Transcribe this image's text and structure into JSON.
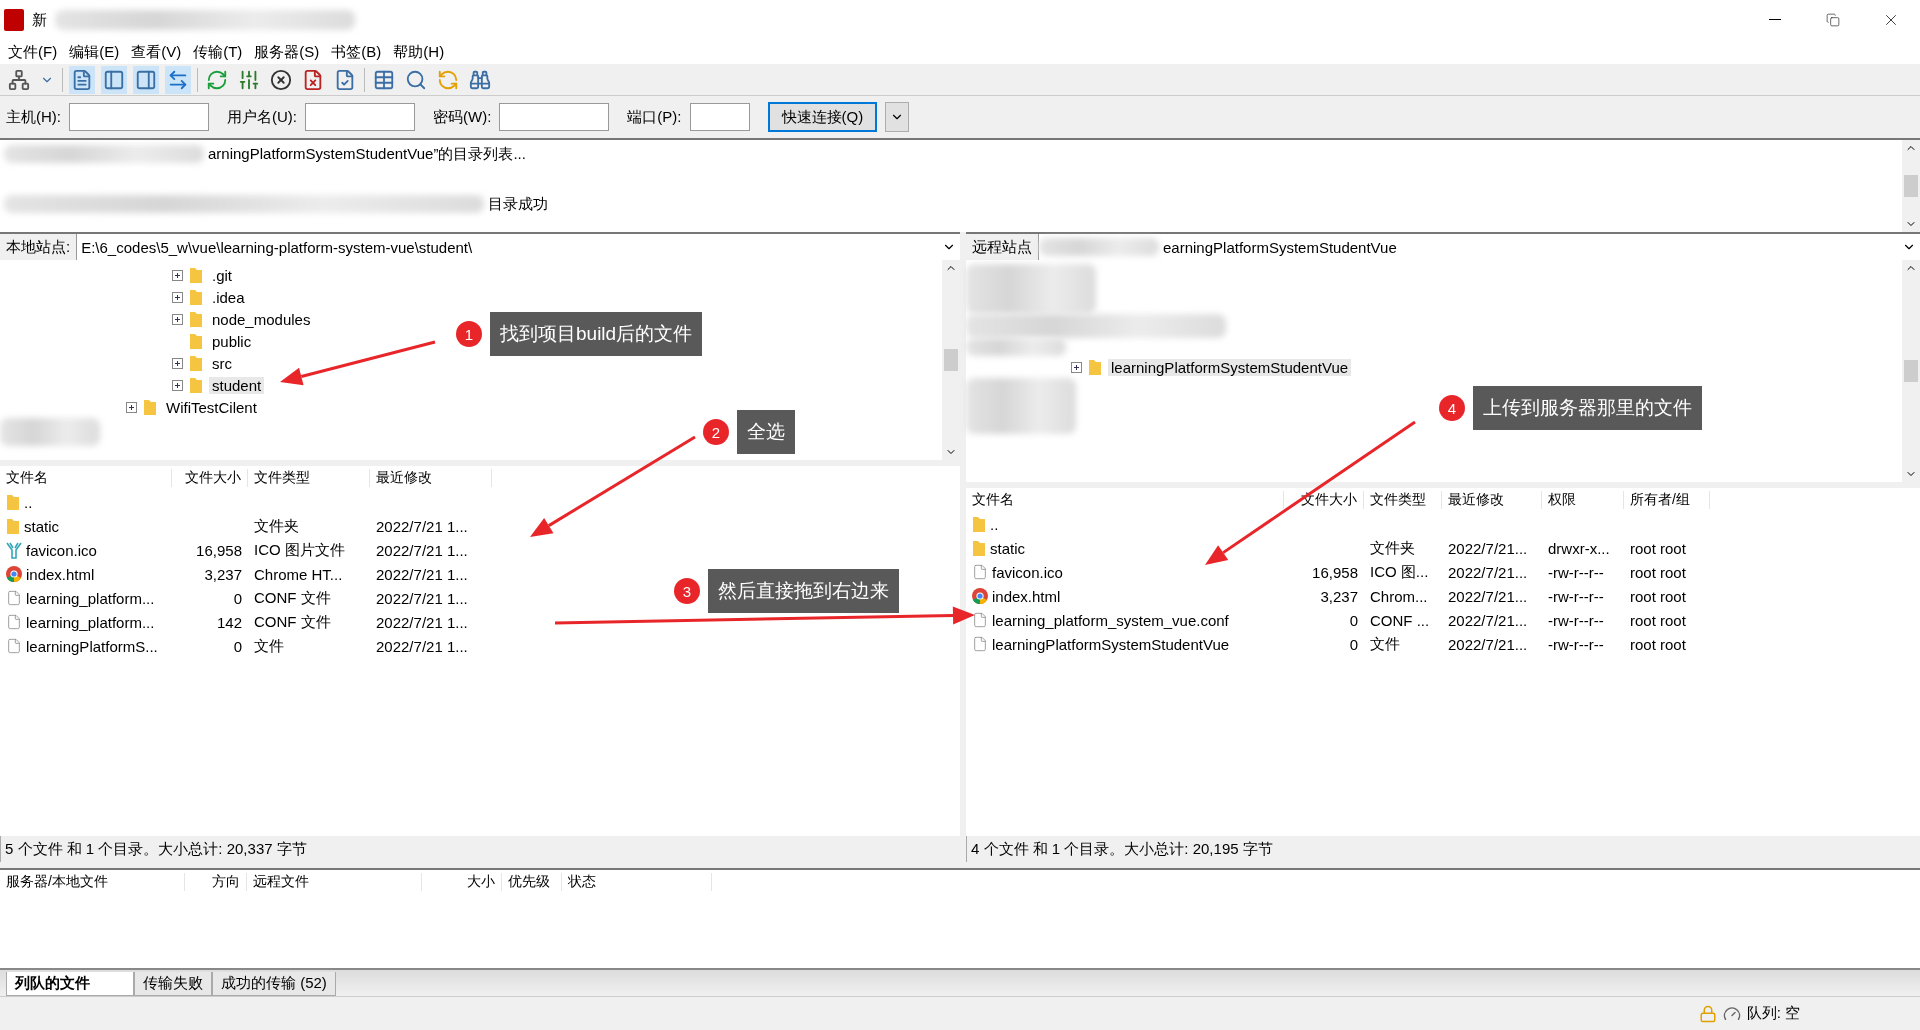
{
  "window": {
    "title": "新"
  },
  "menu": [
    "文件(F)",
    "编辑(E)",
    "查看(V)",
    "传输(T)",
    "服务器(S)",
    "书签(B)",
    "帮助(H)"
  ],
  "quickconnect": {
    "fields": [
      {
        "label": "主机(H):"
      },
      {
        "label": "用户名(U):"
      },
      {
        "label": "密码(W):"
      },
      {
        "label": "端口(P):"
      }
    ],
    "button": "快速连接(Q)"
  },
  "log": [
    "arningPlatformSystemStudentVue”的目录列表...",
    "目录成功"
  ],
  "local": {
    "label": "本地站点:",
    "path": "E:\\6_codes\\5_w\\vue\\learning-platform-system-vue\\student\\",
    "tree": [
      {
        "children": [
          {
            "name": ".git",
            "expandable": true,
            "selected": false
          },
          {
            "name": ".idea",
            "expandable": true,
            "selected": false
          },
          {
            "name": "node_modules",
            "expandable": true,
            "selected": false
          },
          {
            "name": "public",
            "expandable": false,
            "selected": false
          },
          {
            "name": "src",
            "expandable": true,
            "selected": false
          },
          {
            "name": "student",
            "expandable": true,
            "selected": true
          }
        ]
      },
      {
        "name": "WifiTestCilent",
        "expandable": true,
        "selected": false
      }
    ],
    "columns": [
      "文件名",
      "文件大小",
      "文件类型",
      "最近修改"
    ],
    "files": [
      {
        "kind": "folder",
        "cells": [
          "..",
          "",
          "",
          ""
        ]
      },
      {
        "kind": "folder",
        "cells": [
          "static",
          "",
          "文件夹",
          "2022/7/21 1..."
        ]
      },
      {
        "kind": "ico",
        "cells": [
          "favicon.ico",
          "16,958",
          "ICO 图片文件",
          "2022/7/21 1..."
        ]
      },
      {
        "kind": "chrome",
        "cells": [
          "index.html",
          "3,237",
          "Chrome HT...",
          "2022/7/21 1..."
        ]
      },
      {
        "kind": "file",
        "cells": [
          "learning_platform...",
          "0",
          "CONF 文件",
          "2022/7/21 1..."
        ]
      },
      {
        "kind": "file",
        "cells": [
          "learning_platform...",
          "142",
          "CONF 文件",
          "2022/7/21 1..."
        ]
      },
      {
        "kind": "file",
        "cells": [
          "learningPlatformS...",
          "0",
          "文件",
          "2022/7/21 1..."
        ]
      }
    ],
    "status": "5 个文件 和 1 个目录。大小总计: 20,337 字节"
  },
  "remote": {
    "label": "远程站点",
    "path": "earningPlatformSystemStudentVue",
    "tree": [
      {
        "name": "learningPlatformSystemStudentVue",
        "expandable": true,
        "selected": true
      }
    ],
    "columns": [
      "文件名",
      "文件大小",
      "文件类型",
      "最近修改",
      "权限",
      "所有者/组"
    ],
    "files": [
      {
        "kind": "folder",
        "cells": [
          "..",
          "",
          "",
          "",
          "",
          ""
        ]
      },
      {
        "kind": "folder",
        "cells": [
          "static",
          "",
          "文件夹",
          "2022/7/21...",
          "drwxr-x...",
          "root root"
        ]
      },
      {
        "kind": "file",
        "cells": [
          "favicon.ico",
          "16,958",
          "ICO 图...",
          "2022/7/21...",
          "-rw-r--r--",
          "root root"
        ]
      },
      {
        "kind": "chrome",
        "cells": [
          "index.html",
          "3,237",
          "Chrom...",
          "2022/7/21...",
          "-rw-r--r--",
          "root root"
        ]
      },
      {
        "kind": "file",
        "cells": [
          "learning_platform_system_vue.conf",
          "0",
          "CONF ...",
          "2022/7/21...",
          "-rw-r--r--",
          "root root"
        ]
      },
      {
        "kind": "file",
        "cells": [
          "learningPlatformSystemStudentVue",
          "0",
          "文件",
          "2022/7/21...",
          "-rw-r--r--",
          "root root"
        ]
      }
    ],
    "status": "4 个文件 和 1 个目录。大小总计: 20,195 字节"
  },
  "queue": {
    "columns": [
      "服务器/本地文件",
      "方向",
      "远程文件",
      "大小",
      "优先级",
      "状态"
    ]
  },
  "tabs": [
    {
      "label": "列队的文件",
      "selected": true
    },
    {
      "label": "传输失败",
      "selected": false
    },
    {
      "label": "成功的传输 (52)",
      "selected": false
    }
  ],
  "status_bar": {
    "queue": "队列: 空"
  },
  "annotations": [
    {
      "number": "1",
      "text": "找到项目build后的文件"
    },
    {
      "number": "2",
      "text": "全选"
    },
    {
      "number": "3",
      "text": "然后直接拖到右边来"
    },
    {
      "number": "4",
      "text": "上传到服务器那里的文件"
    }
  ]
}
